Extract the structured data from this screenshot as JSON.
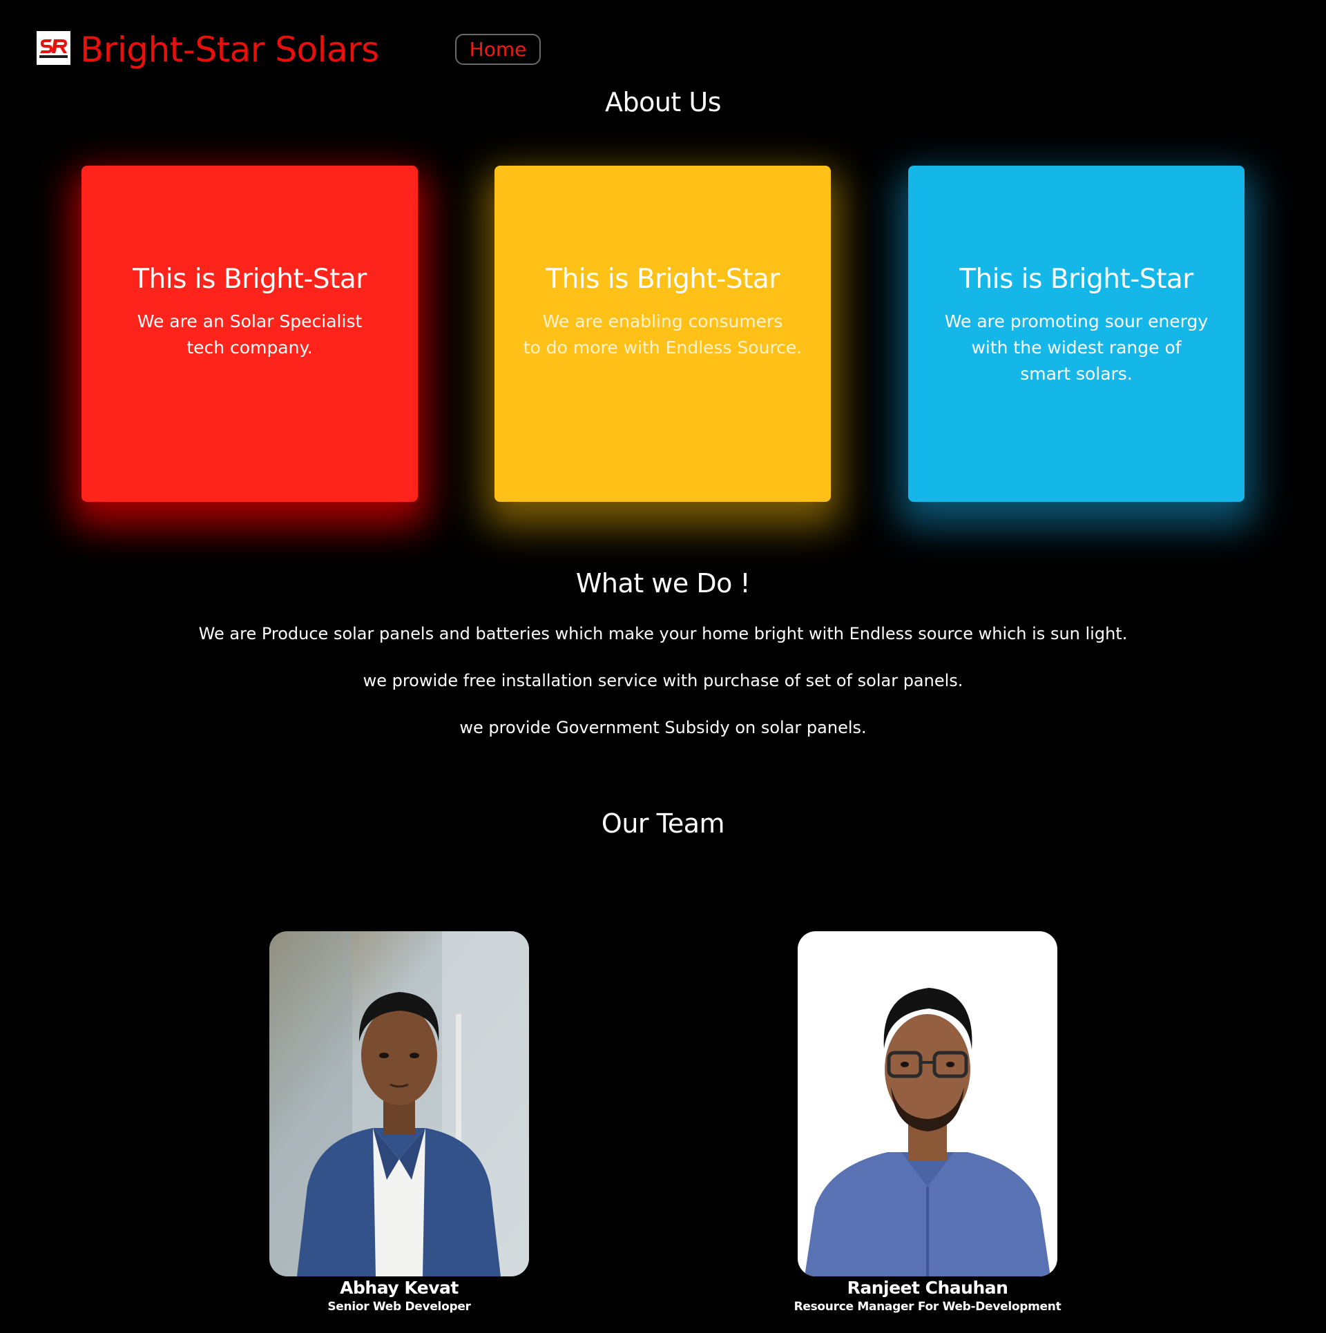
{
  "header": {
    "brand": "Bright-Star Solars",
    "nav": {
      "home_label": "Home"
    }
  },
  "about": {
    "title": "About Us",
    "cards": [
      {
        "title": "This is Bright-Star",
        "text": "We are an Solar Specialist\ntech company.",
        "color": "#ff241b"
      },
      {
        "title": "This is Bright-Star",
        "text": "We are enabling consumers\nto do more with Endless Source.",
        "color": "#ffc117"
      },
      {
        "title": "This is Bright-Star",
        "text": "We are promoting sour energy\nwith the widest range of\nsmart solars.",
        "color": "#15b7e8"
      }
    ]
  },
  "what_we_do": {
    "title": "What we Do !",
    "lines": [
      "We are Produce solar panels and batteries which make your home bright with Endless source which is sun light.",
      "we prowide free installation service with purchase of set of solar panels.",
      "we provide Government Subsidy on solar panels."
    ]
  },
  "team": {
    "title": "Our Team",
    "members": [
      {
        "name": "Abhay Kevat",
        "role": "Senior Web Developer"
      },
      {
        "name": "Ranjeet Chauhan",
        "role": "Resource Manager For Web-Development"
      }
    ]
  },
  "colors": {
    "background": "#000000",
    "brand": "#e8100b",
    "text": "#ffffff"
  },
  "icons": {
    "logo": "sr-logo-icon"
  }
}
